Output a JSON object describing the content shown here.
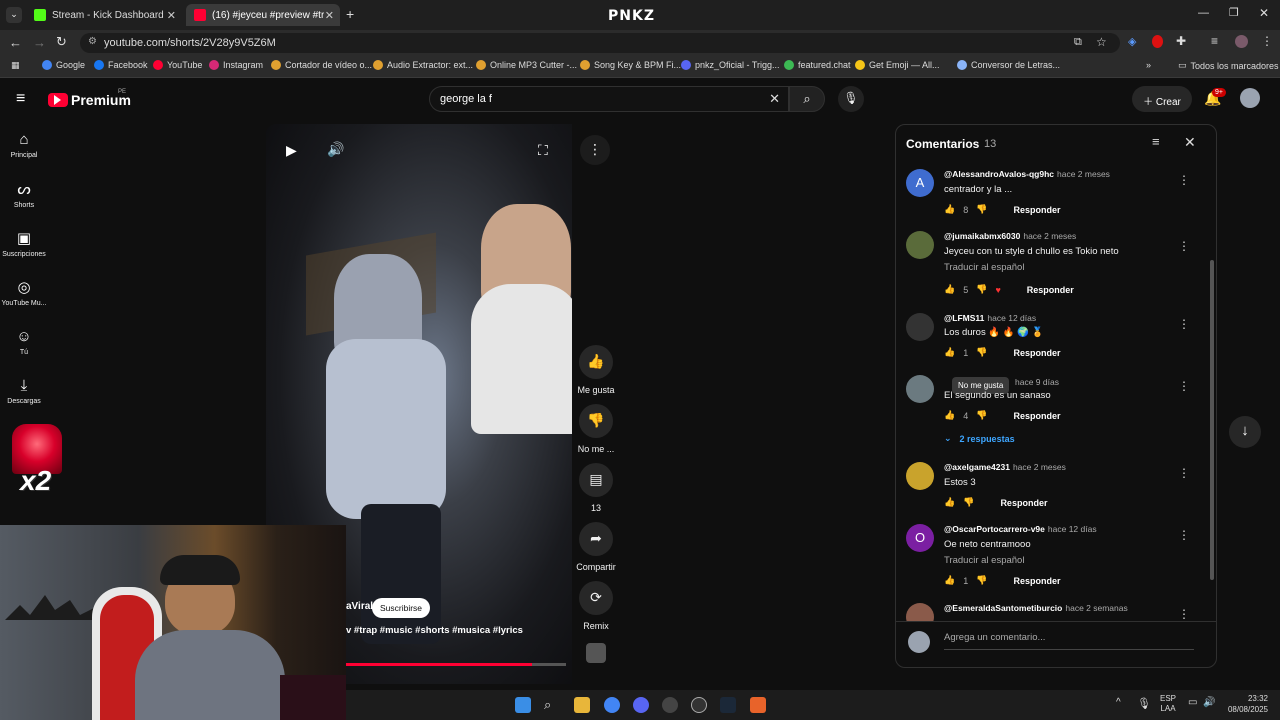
{
  "browser": {
    "tabs": [
      {
        "label": "Stream - Kick Dashboard",
        "color": "#53fc18"
      },
      {
        "label": "(16) #jeyceu #preview #trap #",
        "color": "#ff0033"
      }
    ],
    "new_tab": "+",
    "brand": "PNKZ",
    "url": "youtube.com/shorts/2V28y9V5Z6M",
    "bookmarks": [
      "Google",
      "Facebook",
      "YouTube",
      "Instagram",
      "Cortador de vídeo o...",
      "Audio Extractor: ext...",
      "Online MP3 Cutter -...",
      "Song Key & BPM Fi...",
      "pnkz_Oficial - Trigg...",
      "featured.chat",
      "Get Emoji — All...",
      "Conversor de Letras..."
    ],
    "all_bookmarks": "Todos los marcadores"
  },
  "youtube": {
    "logo": "Premium",
    "region": "PE",
    "search_value": "george la f",
    "create_label": "Crear",
    "notif_count": "9+",
    "sidebar": [
      {
        "label": "Principal",
        "icon": "home-icon"
      },
      {
        "label": "Shorts",
        "icon": "shorts-icon"
      },
      {
        "label": "Suscripciones",
        "icon": "subscriptions-icon"
      },
      {
        "label": "YouTube Mu...",
        "icon": "music-icon"
      },
      {
        "label": "Tú",
        "icon": "you-icon"
      },
      {
        "label": "Descargas",
        "icon": "download-icon"
      }
    ],
    "video": {
      "channel_fragment": "aViral",
      "subscribe": "Suscribirse",
      "hashtags": "v #trap #music  #shorts #musica #lyrics"
    },
    "actions": {
      "like": "Me gusta",
      "dislike": "No me ...",
      "comments": "13",
      "share": "Compartir",
      "remix": "Remix"
    },
    "comments_panel": {
      "title": "Comentarios",
      "count": "13",
      "tooltip": "No me gusta",
      "add_placeholder": "Agrega un comentario...",
      "items": [
        {
          "user": "@AlessandroAvalos-qg9hc",
          "ago": "hace 2 meses",
          "text": "centrador y la ...",
          "likes": "8",
          "reply": "Responder",
          "avatar": "A",
          "avatar_color": "#3f6ccf"
        },
        {
          "user": "@jumaikabmx6030",
          "ago": "hace 2 meses",
          "text": "Jeyceu con tu style d chullo es Tokio neto",
          "translate": "Traducir al español",
          "likes": "5",
          "reply": "Responder",
          "avatar": "",
          "avatar_color": "#5a6b3a"
        },
        {
          "user": "@LFMS11",
          "ago": "hace 12 días",
          "text": "Los duros 🔥 🔥 🌍 🏅",
          "likes": "1",
          "reply": "Responder",
          "avatar": "",
          "avatar_color": "#333333"
        },
        {
          "user": "@",
          "ago": "hace 9 días",
          "text": "El segundo es un sanaso",
          "likes": "4",
          "reply": "Responder",
          "replies": "2 respuestas",
          "avatar": "",
          "avatar_color": "#6b7a80"
        },
        {
          "user": "@axelgame4231",
          "ago": "hace 2 meses",
          "text": "Estos 3",
          "likes": "",
          "reply": "Responder",
          "avatar": "",
          "avatar_color": "#c9a32c"
        },
        {
          "user": "@OscarPortocarrero-v9e",
          "ago": "hace 12 días",
          "text": "Oe neto centramooo",
          "translate": "Traducir al español",
          "likes": "1",
          "reply": "Responder",
          "avatar": "O",
          "avatar_color": "#7b1fa2"
        },
        {
          "user": "@EsmeraldaSantometiburcio",
          "ago": "hace 2 semanas",
          "text": "",
          "likes": "",
          "reply": "",
          "avatar": "",
          "avatar_color": "#8a5a4a"
        }
      ]
    }
  },
  "overlay": {
    "multiplier": "x2"
  },
  "taskbar": {
    "lang": "ESP",
    "lang2": "LAA",
    "time": "23:32",
    "date": "08/08/2025"
  }
}
